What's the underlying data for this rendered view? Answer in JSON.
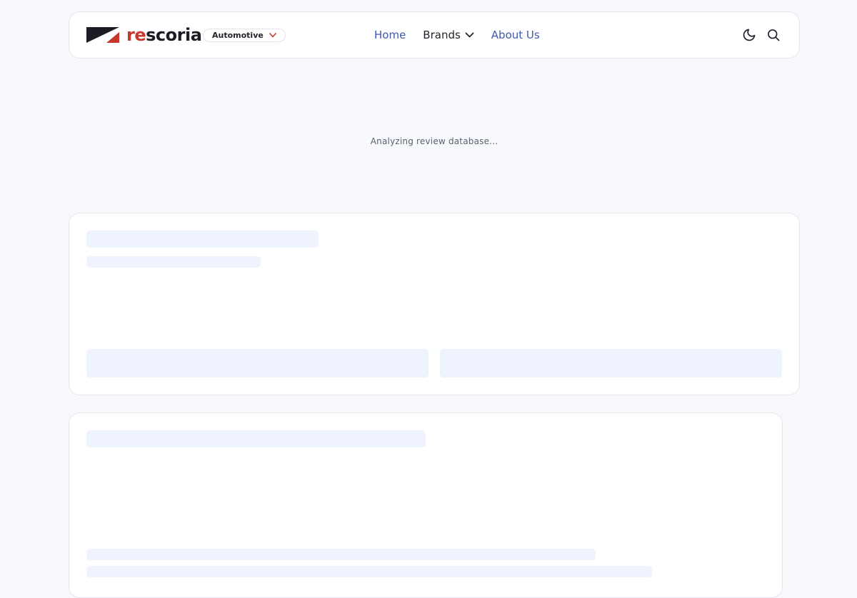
{
  "brand": {
    "name_accent": "re",
    "name_rest": "scoria",
    "category": "Automotive",
    "accent_color": "#c8372d"
  },
  "nav": {
    "links": [
      {
        "label": "Home"
      },
      {
        "label": "Brands"
      },
      {
        "label": "About Us"
      }
    ],
    "link_color": "#4058b0"
  },
  "icons": {
    "theme_toggle": "moon-icon",
    "search": "search-icon"
  },
  "status": {
    "loading_message": "Analyzing review database..."
  },
  "skeleton_color": "#eef3fd"
}
